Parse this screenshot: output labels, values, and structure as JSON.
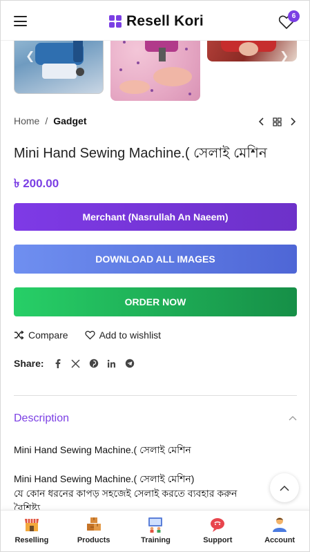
{
  "header": {
    "brand": "Resell Kori",
    "wishlist_count": "6"
  },
  "breadcrumb": {
    "home": "Home",
    "separator": "/",
    "current": "Gadget"
  },
  "product": {
    "title": "Mini Hand Sewing Machine.( সেলাই মেশিন",
    "price": "৳ 200.00"
  },
  "buttons": {
    "merchant": "Merchant (Nasrullah An Naeem)",
    "download": "DOWNLOAD ALL IMAGES",
    "order": "ORDER NOW"
  },
  "actions": {
    "compare": "Compare",
    "wishlist": "Add to wishlist"
  },
  "share": {
    "label": "Share:",
    "networks": [
      "facebook-icon",
      "x-icon",
      "pinterest-icon",
      "linkedin-icon",
      "telegram-icon"
    ]
  },
  "description": {
    "heading": "Description",
    "lines": [
      "Mini Hand Sewing Machine.( সেলাই মেশিন",
      "Mini Hand Sewing Machine.( সেলাই মেশিন)",
      "যে কোন ধরনের কাপড় সহজেই সেলাই করতে ব্যবহার করুন",
      "বৈশিষ্ট্য"
    ]
  },
  "bottom_nav": [
    {
      "label": "Reselling",
      "icon": "store-icon"
    },
    {
      "label": "Products",
      "icon": "boxes-icon"
    },
    {
      "label": "Training",
      "icon": "training-icon"
    },
    {
      "label": "Support",
      "icon": "support-icon"
    },
    {
      "label": "Account",
      "icon": "account-icon"
    }
  ],
  "colors": {
    "accent": "#7b3fe4",
    "download": "#5b78e2",
    "order": "#1fb258"
  }
}
